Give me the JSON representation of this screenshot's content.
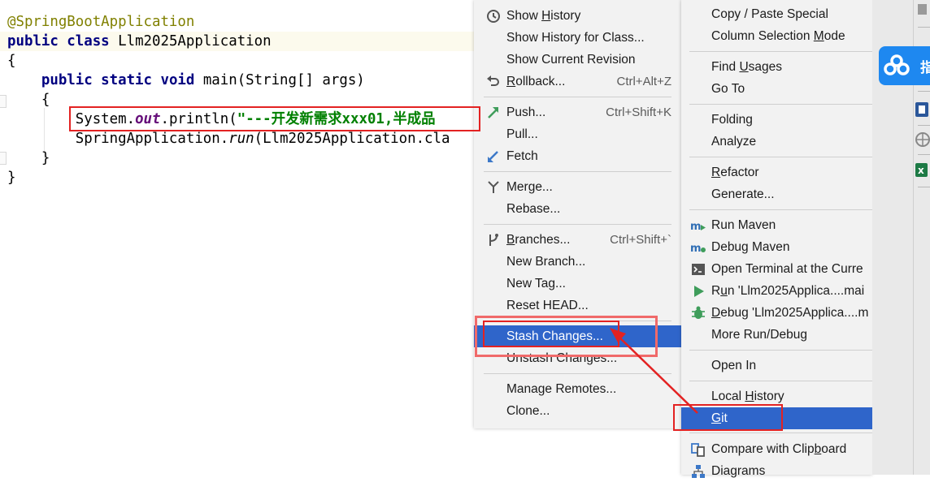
{
  "editor": {
    "lines": [
      {
        "segments": [
          {
            "t": "@SpringBootApplication",
            "c": "ann"
          }
        ]
      },
      {
        "segments": [
          {
            "t": "public class ",
            "c": "kw"
          },
          {
            "t": "Llm2025Application",
            "c": ""
          }
        ]
      },
      {
        "segments": [
          {
            "t": "{",
            "c": ""
          }
        ]
      },
      {
        "segments": [
          {
            "t": "    ",
            "c": ""
          },
          {
            "t": "public static void ",
            "c": "kw"
          },
          {
            "t": "main(String[] args)",
            "c": ""
          }
        ]
      },
      {
        "segments": [
          {
            "t": "    {",
            "c": ""
          }
        ]
      },
      {
        "segments": [
          {
            "t": "        System.",
            "c": ""
          },
          {
            "t": "out",
            "c": "fld"
          },
          {
            "t": ".println(",
            "c": ""
          },
          {
            "t": "\"---开发新需求xxx01,半成品",
            "c": "str"
          }
        ]
      },
      {
        "segments": [
          {
            "t": "        SpringApplication.",
            "c": ""
          },
          {
            "t": "run",
            "c": "itl"
          },
          {
            "t": "(Llm2025Application.cla",
            "c": ""
          }
        ]
      },
      {
        "segments": [
          {
            "t": "    }",
            "c": ""
          }
        ]
      },
      {
        "segments": [
          {
            "t": "}",
            "c": ""
          }
        ]
      }
    ]
  },
  "git_menu": {
    "items": [
      {
        "label": "Show History",
        "mn": "H",
        "shortcut": "",
        "icon": "clock-icon"
      },
      {
        "label": "Show History for Class...",
        "shortcut": "",
        "icon": ""
      },
      {
        "label": "Show Current Revision",
        "shortcut": "",
        "icon": ""
      },
      {
        "label": "Rollback...",
        "mn": "R",
        "shortcut": "Ctrl+Alt+Z",
        "icon": "rollback-icon"
      },
      {
        "label": "Push...",
        "shortcut": "Ctrl+Shift+K",
        "icon": "push-icon"
      },
      {
        "label": "Pull...",
        "shortcut": "",
        "icon": ""
      },
      {
        "label": "Fetch",
        "shortcut": "",
        "icon": "fetch-icon"
      },
      {
        "label": "Merge...",
        "shortcut": "",
        "icon": "merge-icon"
      },
      {
        "label": "Rebase...",
        "shortcut": "",
        "icon": ""
      },
      {
        "label": "Branches...",
        "mn": "B",
        "shortcut": "Ctrl+Shift+`",
        "icon": "branch-icon"
      },
      {
        "label": "New Branch...",
        "shortcut": "",
        "icon": ""
      },
      {
        "label": "New Tag...",
        "shortcut": "",
        "icon": ""
      },
      {
        "label": "Reset HEAD...",
        "shortcut": "",
        "icon": ""
      },
      {
        "label": "Stash Changes...",
        "shortcut": "",
        "icon": "",
        "selected": true
      },
      {
        "label": "Unstash Changes...",
        "shortcut": "",
        "icon": ""
      },
      {
        "label": "Manage Remotes...",
        "shortcut": "",
        "icon": ""
      },
      {
        "label": "Clone...",
        "shortcut": "",
        "icon": ""
      }
    ]
  },
  "context_menu": {
    "items": [
      {
        "label": "Copy / Paste Special",
        "icon": ""
      },
      {
        "label": "Column Selection Mode",
        "mn": "M",
        "icon": ""
      },
      {
        "label": "Find Usages",
        "mn": "U",
        "icon": ""
      },
      {
        "label": "Go To",
        "icon": ""
      },
      {
        "label": "Folding",
        "icon": ""
      },
      {
        "label": "Analyze",
        "icon": ""
      },
      {
        "label": "Refactor",
        "mn": "R",
        "icon": ""
      },
      {
        "label": "Generate...",
        "icon": ""
      },
      {
        "label": "Run Maven",
        "icon": "maven-run-icon"
      },
      {
        "label": "Debug Maven",
        "icon": "maven-debug-icon"
      },
      {
        "label": "Open Terminal at the Curre",
        "icon": "terminal-icon"
      },
      {
        "label": "Run 'Llm2025Applica....mai",
        "mn": "u",
        "icon": "run-icon"
      },
      {
        "label": "Debug 'Llm2025Applica....m",
        "mn": "D",
        "icon": "debug-icon"
      },
      {
        "label": "More Run/Debug",
        "icon": ""
      },
      {
        "label": "Open In",
        "icon": ""
      },
      {
        "label": "Local History",
        "mn": "H",
        "icon": ""
      },
      {
        "label": "Git",
        "mn": "G",
        "icon": "",
        "selected": true
      },
      {
        "label": "Compare with Clipboard",
        "mn": "b",
        "icon": "compare-icon"
      },
      {
        "label": "Diagrams",
        "icon": "diagram-icon"
      }
    ]
  },
  "sidebar": {
    "baidu_label": "指"
  },
  "colors": {
    "selection": "#2f65ca",
    "annotation_red": "#e32222",
    "baidu_blue": "#1e88f0"
  }
}
